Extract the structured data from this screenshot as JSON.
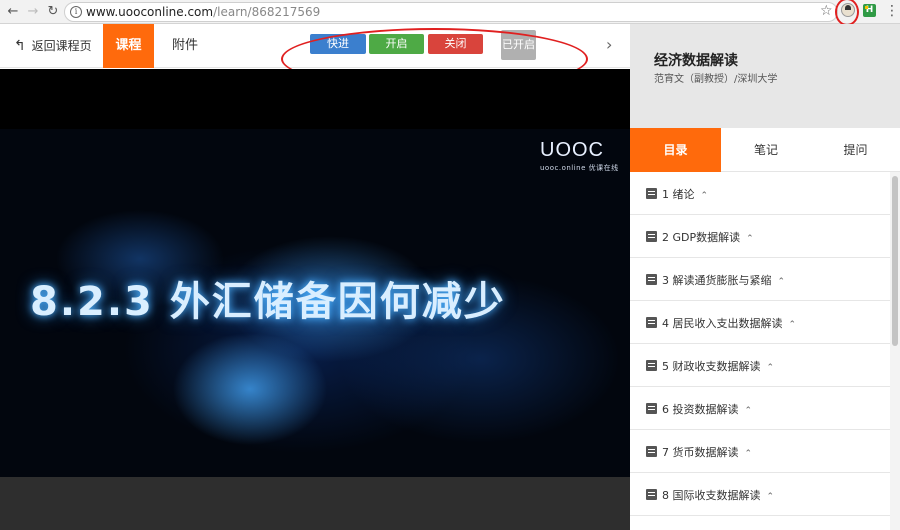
{
  "browser": {
    "back": "←",
    "forward": "→",
    "reload": "↻",
    "info_icon": "i",
    "url_host": "www.uooconline.com",
    "url_path": "/learn/868217569",
    "star_icon": "☆",
    "extension_letter": "H",
    "menu_icon": "⋮"
  },
  "topbar": {
    "back_arrow": "↰",
    "back_label": "返回课程页",
    "tab_course": "课程",
    "tab_attachment": "附件",
    "btn_fast": "快进",
    "btn_on": "开启",
    "btn_off": "关闭",
    "btn_already_on": "已开启",
    "next": "›"
  },
  "video": {
    "logo": "UOOC",
    "logo_sub": "uooc.online 优课在线",
    "title": "8.2.3 外汇储备因何减少"
  },
  "sidebar": {
    "course_title": "经济数据解读",
    "teacher": "范宵文（副教授）/深圳大学",
    "tabs": [
      "目录",
      "笔记",
      "提问"
    ],
    "caret": "⌃",
    "chapters": [
      "1 绪论",
      "2 GDP数据解读",
      "3 解读通货膨胀与紧缩",
      "4 居民收入支出数据解读",
      "5 财政收支数据解读",
      "6 投资数据解读",
      "7 货币数据解读",
      "8 国际收支数据解读"
    ]
  },
  "colors": {
    "accent": "#ff6a0c",
    "btn_fast": "#3b7fce",
    "btn_on": "#4eaa45",
    "btn_off": "#d9443c",
    "btn_disabled": "#b0b0b0",
    "annotation": "#e02020"
  }
}
